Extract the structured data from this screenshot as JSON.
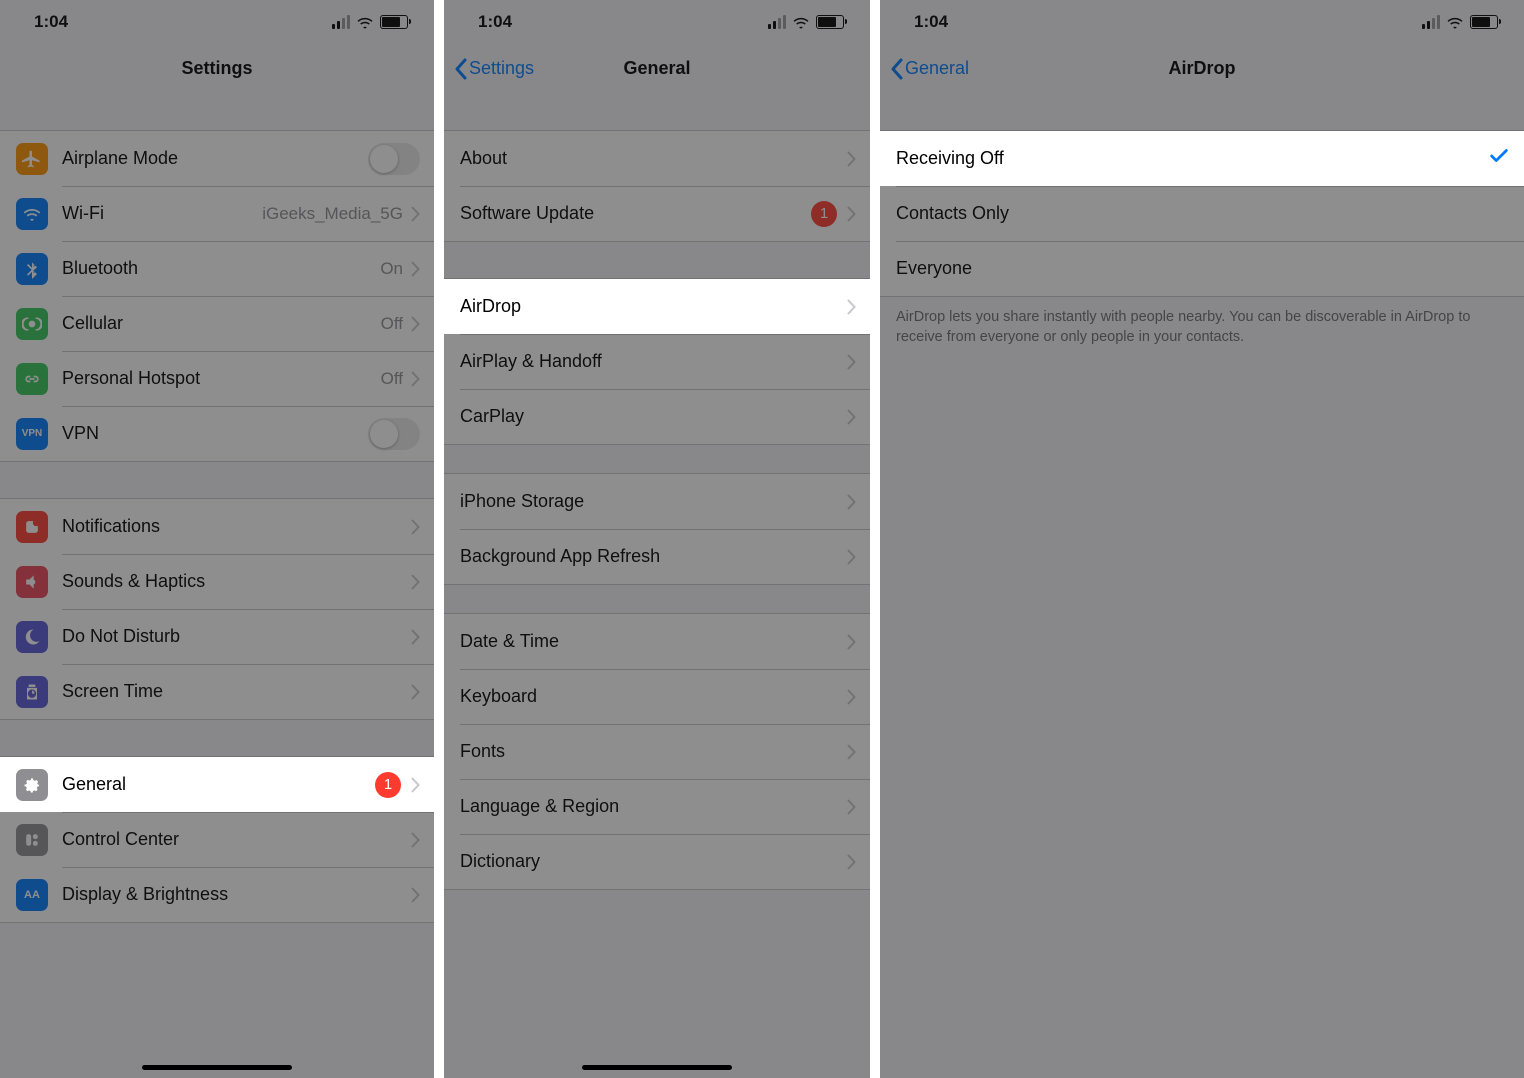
{
  "status": {
    "time": "1:04"
  },
  "panelA": {
    "title": "Settings",
    "group1": [
      {
        "icon": "airplane",
        "label": "Airplane Mode",
        "type": "switch",
        "value": "off"
      },
      {
        "icon": "wifi",
        "label": "Wi-Fi",
        "detail": "iGeeks_Media_5G",
        "type": "push"
      },
      {
        "icon": "bluetooth",
        "label": "Bluetooth",
        "detail": "On",
        "type": "push"
      },
      {
        "icon": "cellular",
        "label": "Cellular",
        "detail": "Off",
        "type": "push"
      },
      {
        "icon": "hotspot",
        "label": "Personal Hotspot",
        "detail": "Off",
        "type": "push"
      },
      {
        "icon": "vpn",
        "label": "VPN",
        "type": "switch",
        "value": "off"
      }
    ],
    "group2": [
      {
        "icon": "notifications",
        "label": "Notifications",
        "type": "push"
      },
      {
        "icon": "sounds",
        "label": "Sounds & Haptics",
        "type": "push"
      },
      {
        "icon": "dnd",
        "label": "Do Not Disturb",
        "type": "push"
      },
      {
        "icon": "screentime",
        "label": "Screen Time",
        "type": "push"
      }
    ],
    "group3": [
      {
        "icon": "general",
        "label": "General",
        "badge": "1",
        "type": "push",
        "highlight": true
      },
      {
        "icon": "controlcenter",
        "label": "Control Center",
        "type": "push"
      },
      {
        "icon": "display",
        "label": "Display & Brightness",
        "type": "push"
      }
    ]
  },
  "panelB": {
    "back": "Settings",
    "title": "General",
    "group1": [
      {
        "label": "About",
        "type": "push"
      },
      {
        "label": "Software Update",
        "badge": "1",
        "type": "push"
      }
    ],
    "group2": [
      {
        "label": "AirDrop",
        "type": "push",
        "highlight": true
      },
      {
        "label": "AirPlay & Handoff",
        "type": "push"
      },
      {
        "label": "CarPlay",
        "type": "push"
      }
    ],
    "group3": [
      {
        "label": "iPhone Storage",
        "type": "push"
      },
      {
        "label": "Background App Refresh",
        "type": "push"
      }
    ],
    "group4": [
      {
        "label": "Date & Time",
        "type": "push"
      },
      {
        "label": "Keyboard",
        "type": "push"
      },
      {
        "label": "Fonts",
        "type": "push"
      },
      {
        "label": "Language & Region",
        "type": "push"
      },
      {
        "label": "Dictionary",
        "type": "push"
      }
    ]
  },
  "panelC": {
    "back": "General",
    "title": "AirDrop",
    "options": [
      {
        "label": "Receiving Off",
        "selected": true,
        "highlight": true
      },
      {
        "label": "Contacts Only",
        "selected": false
      },
      {
        "label": "Everyone",
        "selected": false
      }
    ],
    "footer": "AirDrop lets you share instantly with people nearby. You can be discoverable in AirDrop to receive from everyone or only people in your contacts."
  }
}
